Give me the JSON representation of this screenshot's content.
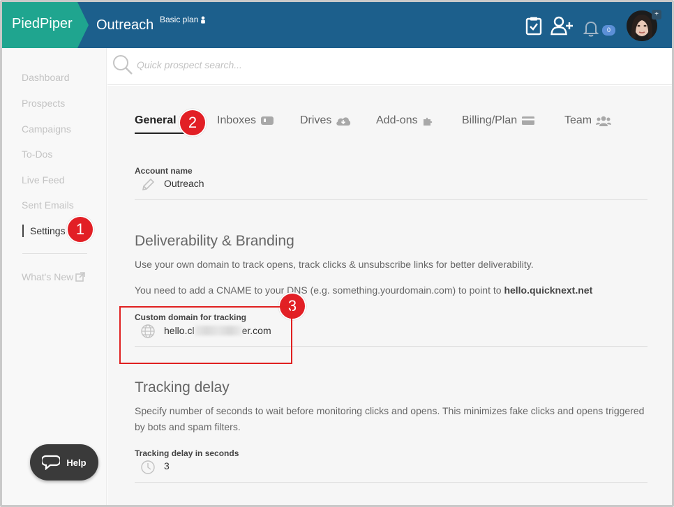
{
  "header": {
    "brand": "PiedPiper",
    "title": "Outreach",
    "plan": "Basic plan",
    "notification_count": "0",
    "avatar_plus": "+"
  },
  "sidebar": {
    "items": [
      {
        "label": "Dashboard"
      },
      {
        "label": "Prospects"
      },
      {
        "label": "Campaigns"
      },
      {
        "label": "To-Dos"
      },
      {
        "label": "Live Feed"
      },
      {
        "label": "Sent Emails"
      },
      {
        "label": "Settings"
      }
    ],
    "whats_new": "What's New"
  },
  "search": {
    "placeholder": "Quick prospect search..."
  },
  "tabs": [
    {
      "label": "General",
      "icon": "none"
    },
    {
      "label": "Inboxes",
      "icon": "inbox-icon"
    },
    {
      "label": "Drives",
      "icon": "cloud-download-icon"
    },
    {
      "label": "Add-ons",
      "icon": "puzzle-icon"
    },
    {
      "label": "Billing/Plan",
      "icon": "credit-card-icon"
    },
    {
      "label": "Team",
      "icon": "users-icon"
    }
  ],
  "account": {
    "label": "Account name",
    "value": "Outreach"
  },
  "deliverability": {
    "title": "Deliverability & Branding",
    "desc": "Use your own domain to track opens, track clicks & unsubscribe links for better deliverability.",
    "cname_text": "You need to add a CNAME to your DNS (e.g. something.yourdomain.com) to point to ",
    "cname_target": "hello.quicknext.net",
    "domain_label": "Custom domain for tracking",
    "domain_start": "hello.cl",
    "domain_end": "er.com"
  },
  "tracking": {
    "title": "Tracking delay",
    "desc": "Specify number of seconds to wait before monitoring clicks and opens. This minimizes fake clicks and opens triggered by bots and spam filters.",
    "label": "Tracking delay in seconds",
    "value": "3"
  },
  "annotations": {
    "marker1": "1",
    "marker2": "2",
    "marker3": "3",
    "marker_color": "#e21f25"
  },
  "help": {
    "label": "Help"
  },
  "colors": {
    "topbar": "#1c5f8c",
    "brand": "#1fa58f"
  }
}
